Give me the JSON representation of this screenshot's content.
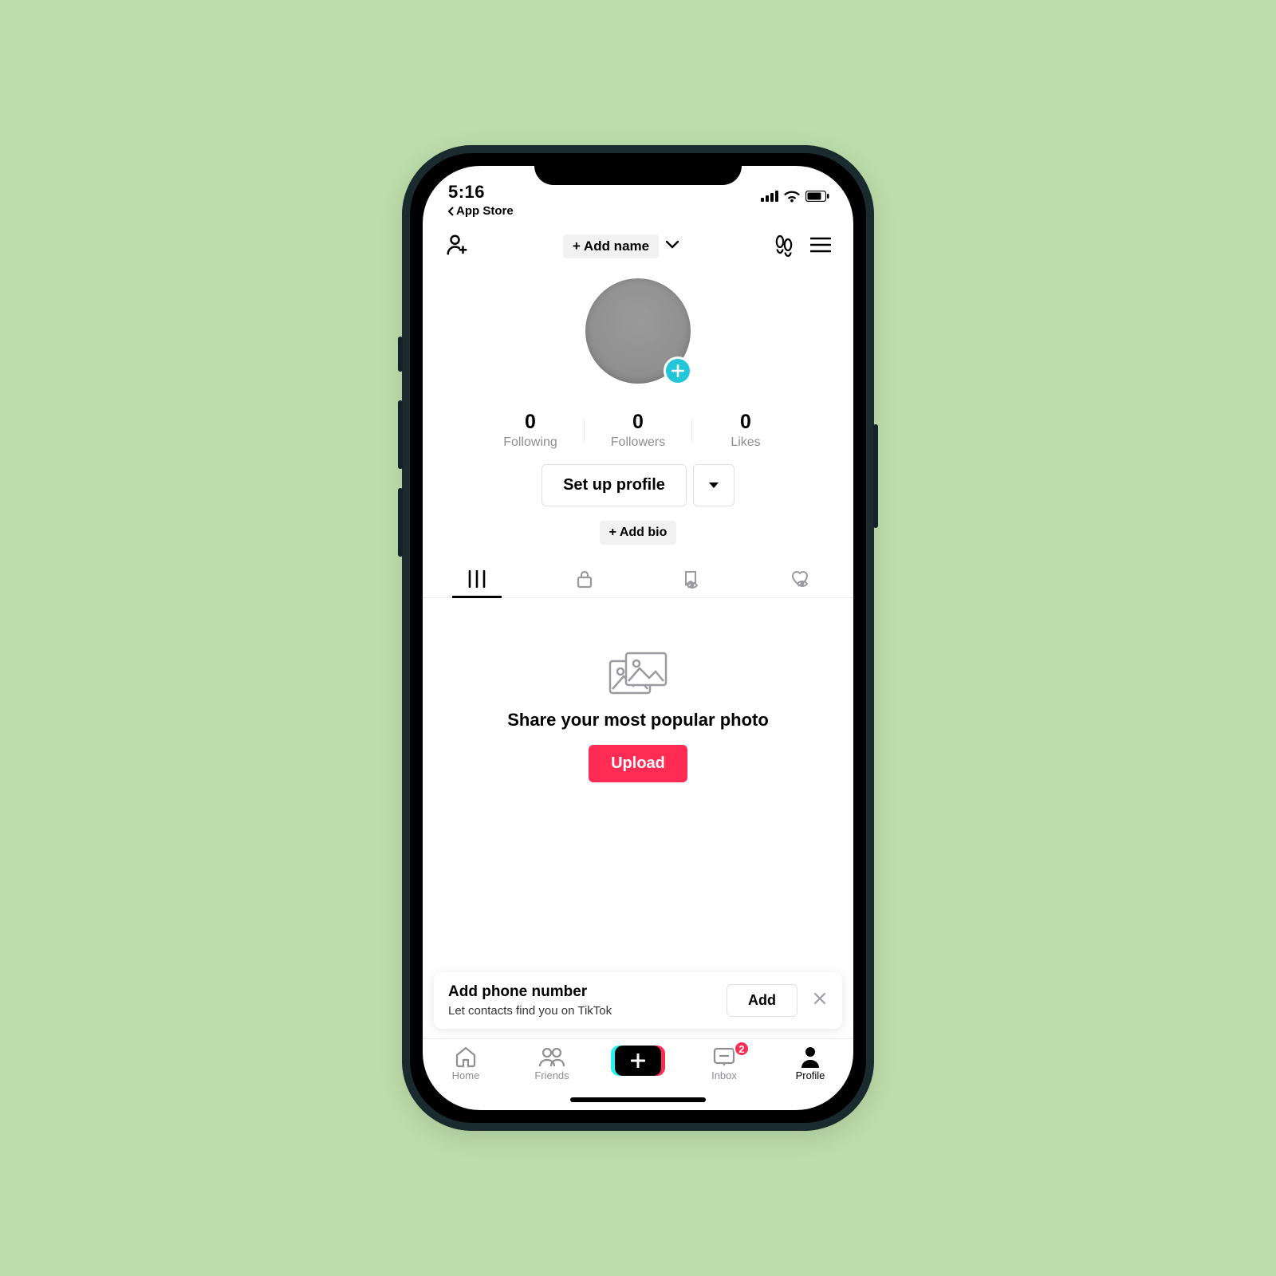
{
  "status": {
    "time": "5:16",
    "back_label": "App Store"
  },
  "header": {
    "add_name_label": "+ Add name"
  },
  "stats": {
    "items": [
      {
        "count": "0",
        "label": "Following"
      },
      {
        "count": "0",
        "label": "Followers"
      },
      {
        "count": "0",
        "label": "Likes"
      }
    ]
  },
  "profile": {
    "setup_label": "Set up profile",
    "add_bio_label": "+ Add bio"
  },
  "empty": {
    "title": "Share your most popular photo",
    "upload_label": "Upload"
  },
  "banner": {
    "title": "Add phone number",
    "subtitle": "Let contacts find you on TikTok",
    "add_label": "Add"
  },
  "nav": {
    "home": "Home",
    "friends": "Friends",
    "inbox": "Inbox",
    "profile": "Profile",
    "inbox_badge": "2"
  },
  "colors": {
    "accent_red": "#fe2c55",
    "accent_teal": "#23c6d8"
  }
}
